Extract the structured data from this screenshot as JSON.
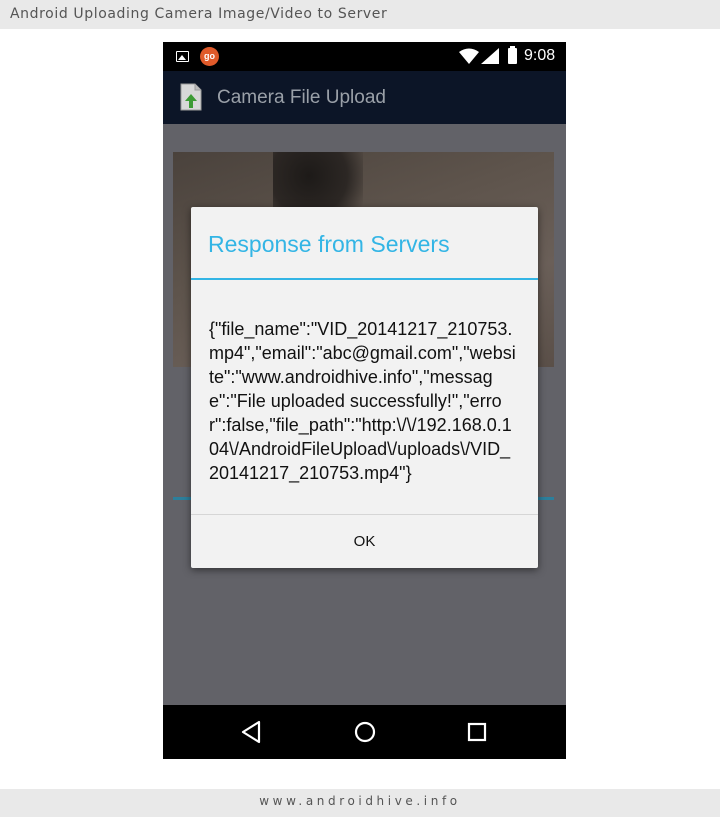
{
  "banner": {
    "title": "Android Uploading Camera Image/Video to Server",
    "footer": "www.androidhive.info"
  },
  "status_bar": {
    "time": "9:08",
    "notification_badge": "go",
    "icons": [
      "gallery-icon",
      "go-icon",
      "wifi-icon",
      "signal-icon",
      "battery-icon"
    ]
  },
  "app_bar": {
    "title": "Camera File Upload",
    "icon": "upload-file-icon"
  },
  "dialog": {
    "title": "Response from Servers",
    "message": "{\"file_name\":\"VID_20141217_210753.mp4\",\"email\":\"abc@gmail.com\",\"website\":\"www.androidhive.info\",\"message\":\"File uploaded successfully!\",\"error\":false,\"file_path\":\"http:\\/\\/192.168.0.104\\/AndroidFileUpload\\/uploads\\/VID_20141217_210753.mp4\"}",
    "ok_label": "OK"
  },
  "nav_bar": {
    "icons": [
      "back-icon",
      "home-icon",
      "recents-icon"
    ]
  },
  "colors": {
    "accent": "#33b5e5",
    "app_bar": "#0c1527",
    "dialog_bg": "#f2f2f2",
    "progress": "#2c7f9c"
  }
}
